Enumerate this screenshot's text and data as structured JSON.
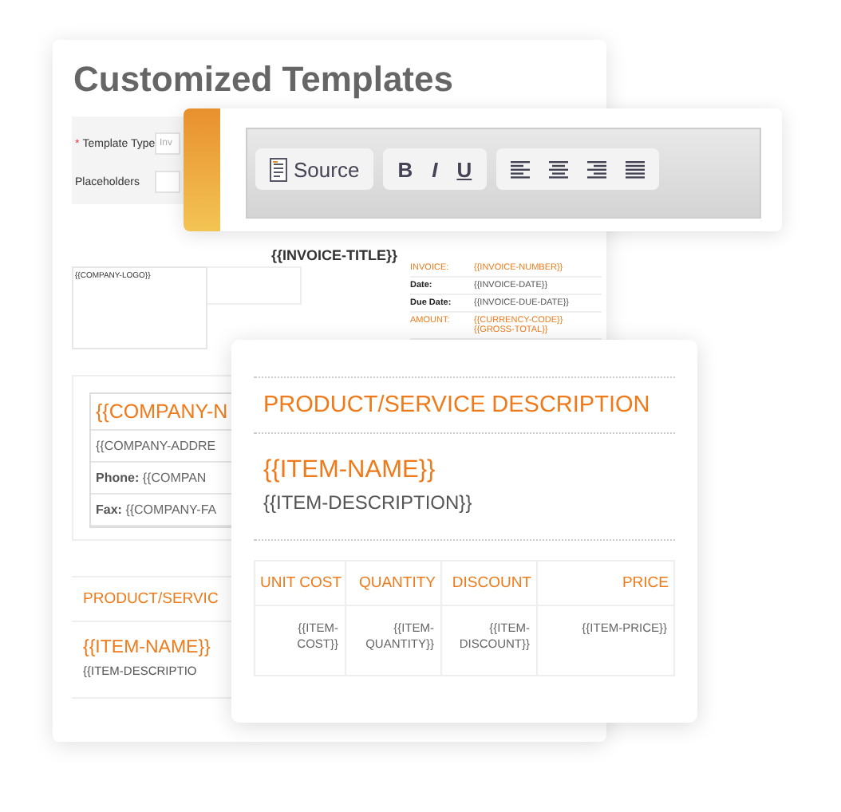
{
  "title": "Customized Templates",
  "form": {
    "fields": [
      {
        "label": "Template Type",
        "marker": "*",
        "value": "Inv"
      },
      {
        "label": "Placeholders"
      }
    ]
  },
  "invoice_title": "{{INVOICE-TITLE}}",
  "logo_cell": "{{COMPANY-LOGO}}",
  "invoice_info": [
    {
      "kind": "accent",
      "label": "INVOICE:",
      "values": [
        "{{INVOICE-NUMBER}}"
      ]
    },
    {
      "kind": "plain",
      "label": "Date:",
      "values": [
        "{{INVOICE-DATE}}"
      ]
    },
    {
      "kind": "plain",
      "label": "Due Date:",
      "values": [
        "{{INVOICE-DUE-DATE}}"
      ]
    },
    {
      "kind": "accent",
      "label": "AMOUNT:",
      "values": [
        "{{CURRENCY-CODE}}",
        "{{GROSS-TOTAL}}"
      ]
    }
  ],
  "company": {
    "name": "{{COMPANY-N",
    "address": "{{COMPANY-ADDRE",
    "phone_label": "Phone:",
    "phone": "{{COMPAN",
    "fax_label": "Fax:",
    "fax": "{{COMPANY-FA"
  },
  "product_section": {
    "heading": "PRODUCT/SERVIC",
    "item_name": "{{ITEM-NAME}}",
    "item_description": "{{ITEM-DESCRIPTIO"
  },
  "toolbar": {
    "groups": [
      [
        {
          "kind": "source",
          "label": "Source"
        }
      ],
      [
        {
          "kind": "bold",
          "label": "B"
        },
        {
          "kind": "italic",
          "label": "I"
        },
        {
          "kind": "underline",
          "label": "U"
        }
      ],
      [
        {
          "kind": "align-left"
        },
        {
          "kind": "align-center"
        },
        {
          "kind": "align-right"
        },
        {
          "kind": "justify"
        }
      ]
    ]
  },
  "detail": {
    "heading": "PRODUCT/SERVICE DESCRIPTION",
    "item_name": "{{ITEM-NAME}}",
    "item_description": "{{ITEM-DESCRIPTION}}",
    "columns": [
      {
        "label": "UNIT COST"
      },
      {
        "label": "QUANTITY"
      },
      {
        "label": "DISCOUNT"
      },
      {
        "label": "PRICE"
      }
    ],
    "rows": [
      [
        "{{ITEM-COST}}",
        "{{ITEM-QUANTITY}}",
        "{{ITEM-DISCOUNT}}",
        "{{ITEM-PRICE}}"
      ]
    ]
  }
}
